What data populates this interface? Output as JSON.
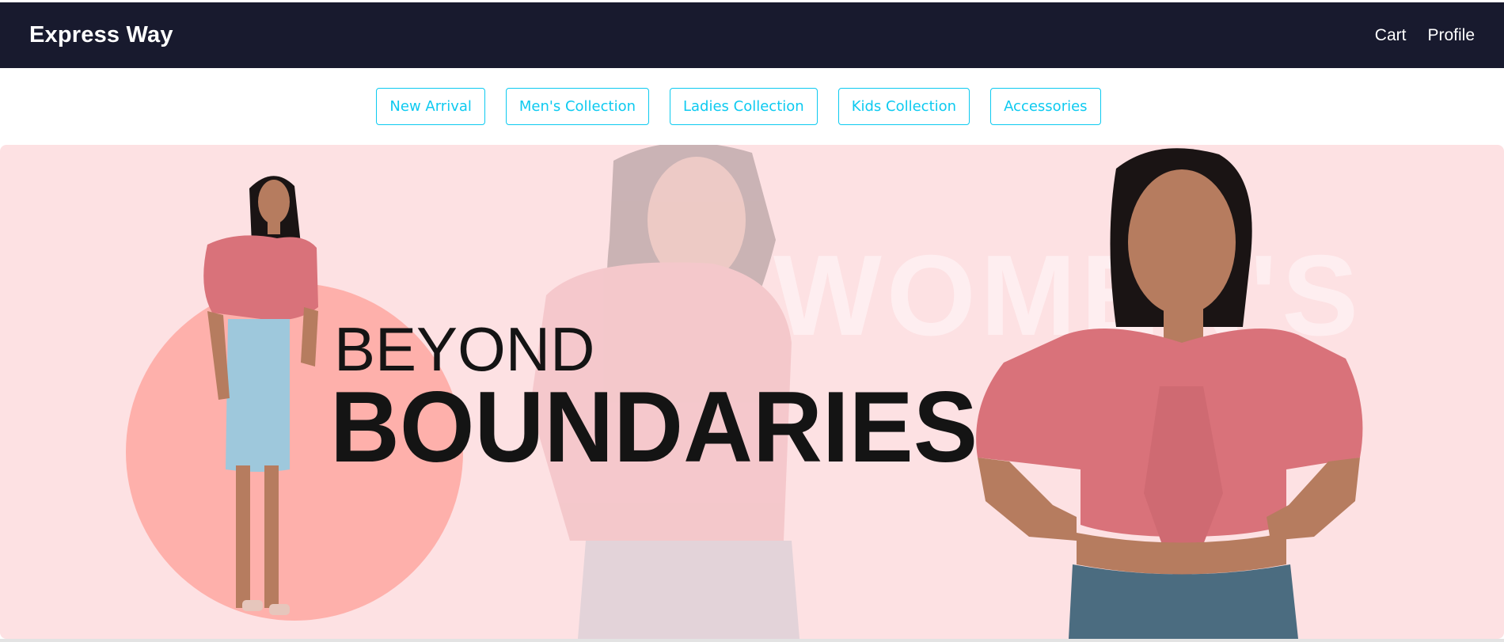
{
  "navbar": {
    "brand": "Express Way",
    "links": [
      "Cart",
      "Profile"
    ]
  },
  "categories": [
    "New Arrival",
    "Men's Collection",
    "Ladies Collection",
    "Kids Collection",
    "Accessories"
  ],
  "banner": {
    "line1": "BEYOND",
    "line2": "BOUNDARIES",
    "watermark": "WOMEN'S",
    "colors": {
      "background": "#fde1e3",
      "circle": "#feb0ab",
      "top": "#d9727a",
      "skirt": "#9ec8dc",
      "jeans": "#4b6c80",
      "skin": "#b67c5f",
      "hair": "#1a1414",
      "text": "#141414"
    }
  },
  "theme": {
    "navbar_bg": "#181a2e",
    "accent": "#0dcaf0"
  }
}
